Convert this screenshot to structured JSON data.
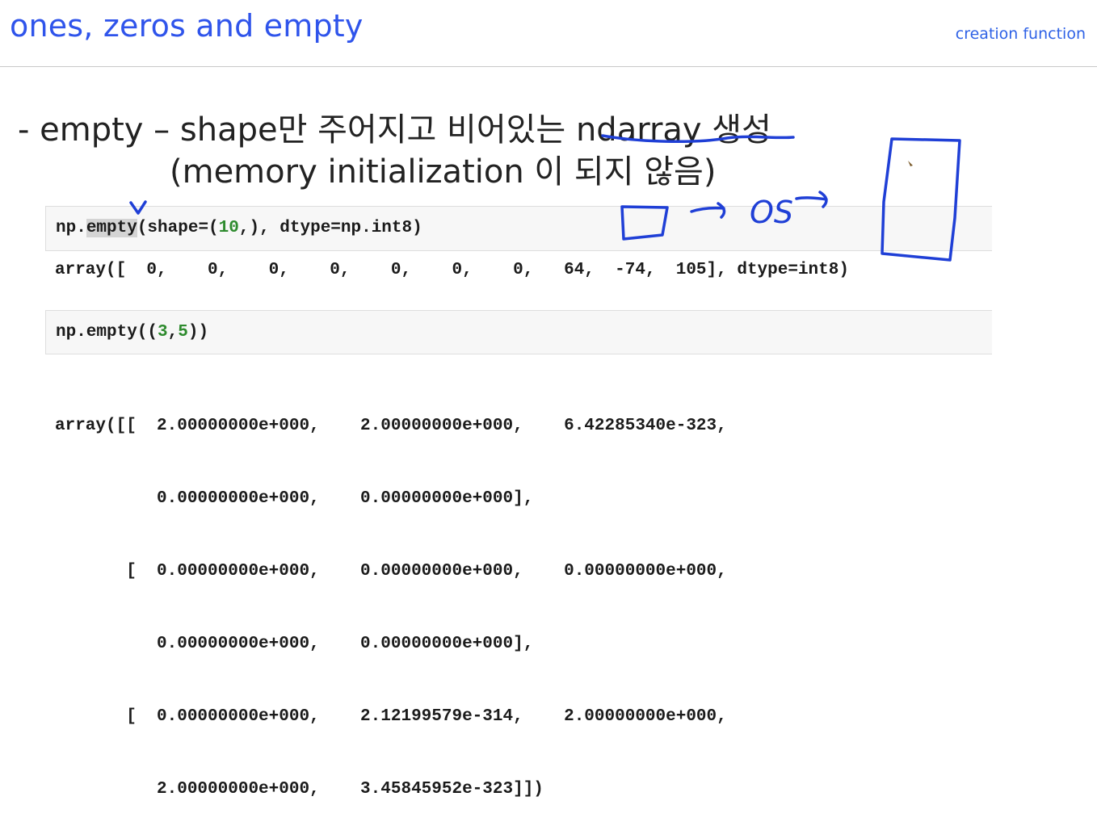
{
  "header": {
    "title": "ones, zeros and empty",
    "subtitle": "creation function"
  },
  "body": {
    "bullet_line1": "- empty – shape만 주어지고 비어있는 ndarray 생성",
    "bullet_line2": "(memory initialization 이 되지 않음)"
  },
  "cells": [
    {
      "input_prefix": "np.",
      "input_highlight": "empty",
      "input_mid": "(shape=(",
      "input_num": "10",
      "input_suffix": ",), dtype=np.int8)",
      "output": "array([  0,    0,    0,    0,    0,    0,    0,   64,  -74,  105], dtype=int8)"
    },
    {
      "input_prefix": "np.empty((",
      "input_num1": "3",
      "input_sep": ",",
      "input_num2": "5",
      "input_suffix": "))",
      "output_lines": [
        "array([[  2.00000000e+000,    2.00000000e+000,    6.42285340e-323,",
        "          0.00000000e+000,    0.00000000e+000],",
        "       [  0.00000000e+000,    0.00000000e+000,    0.00000000e+000,",
        "          0.00000000e+000,    0.00000000e+000],",
        "       [  0.00000000e+000,    2.12199579e-314,    2.00000000e+000,",
        "          2.00000000e+000,    3.45845952e-323]])"
      ]
    }
  ],
  "annotations": {
    "ink_color": "#1f3fd6",
    "handwritten_text": "OS"
  }
}
